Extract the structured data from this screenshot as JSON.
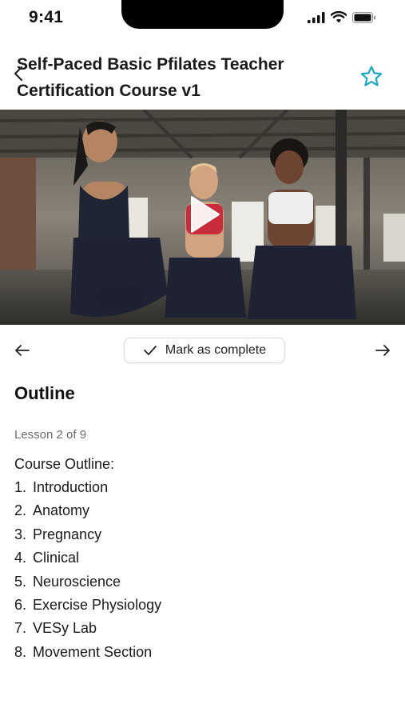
{
  "status_bar": {
    "time": "9:41"
  },
  "header": {
    "title": "Self-Paced Basic Pfilates Teacher Certification Course v1",
    "back_icon": "chevron-left-icon",
    "favorite_icon": "star-outline-icon"
  },
  "video": {
    "thumbnail": "three women in sports outfits laughing in a gym",
    "play_icon": "play-icon"
  },
  "controls": {
    "prev_icon": "arrow-left-icon",
    "complete_label": "Mark as complete",
    "complete_icon": "check-icon",
    "next_icon": "arrow-right-icon"
  },
  "outline": {
    "heading": "Outline",
    "lesson_count": "Lesson 2 of 9",
    "intro": "Course Outline:",
    "items": [
      {
        "num": "1.",
        "label": "Introduction"
      },
      {
        "num": "2.",
        "label": "Anatomy"
      },
      {
        "num": "3.",
        "label": "Pregnancy"
      },
      {
        "num": "4.",
        "label": "Clinical"
      },
      {
        "num": "5.",
        "label": "Neuroscience"
      },
      {
        "num": "6.",
        "label": "Exercise Physiology"
      },
      {
        "num": "7.",
        "label": "VESy Lab"
      },
      {
        "num": "8.",
        "label": "Movement Section"
      }
    ]
  },
  "colors": {
    "accent": "#1aa7c4",
    "text": "#1a1a1a",
    "muted": "#6b6b6b",
    "border": "#d9d9d9"
  }
}
